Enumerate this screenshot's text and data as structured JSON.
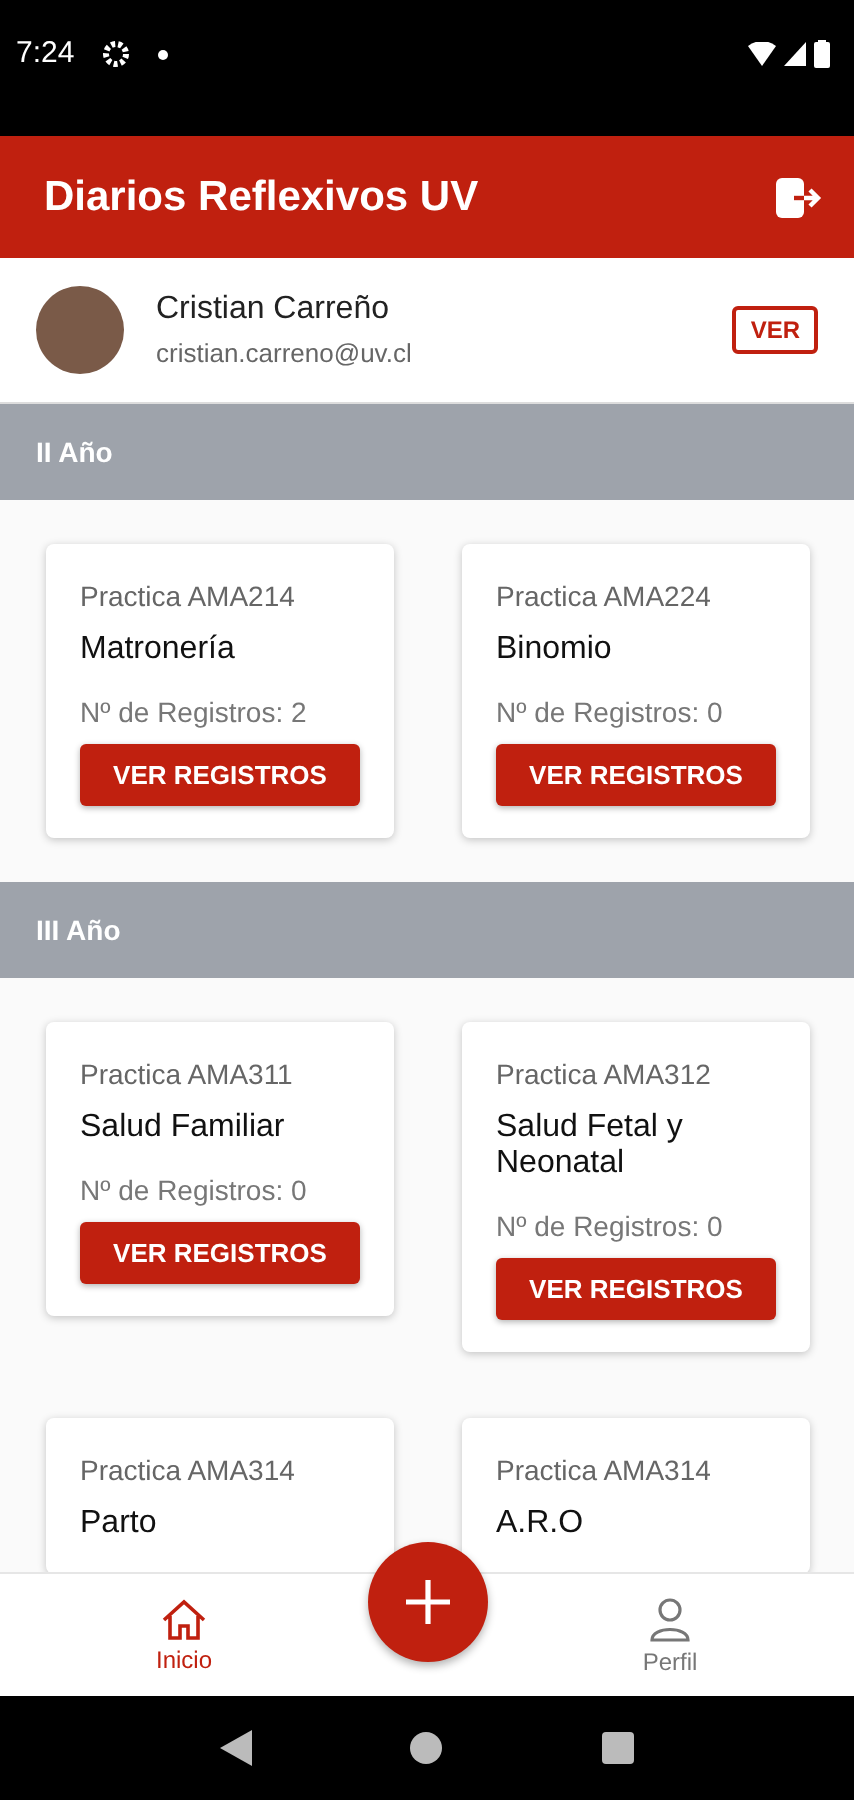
{
  "status_bar": {
    "time": "7:24"
  },
  "app_bar": {
    "title": "Diarios Reflexivos UV"
  },
  "profile": {
    "name": "Cristian Carreño",
    "email": "cristian.carreno@uv.cl",
    "button": "VER"
  },
  "sections": [
    {
      "title": "II Año",
      "courses": [
        {
          "code": "Practica AMA214",
          "name": "Matronería",
          "count": "Nº de Registros: 2",
          "button": "VER REGISTROS"
        },
        {
          "code": "Practica AMA224",
          "name": "Binomio",
          "count": "Nº de Registros: 0",
          "button": "VER REGISTROS"
        }
      ]
    },
    {
      "title": "III Año",
      "courses": [
        {
          "code": "Practica AMA311",
          "name": "Salud Familiar",
          "count": "Nº de Registros: 0",
          "button": "VER REGISTROS"
        },
        {
          "code": "Practica AMA312",
          "name": "Salud Fetal y Neonatal",
          "count": "Nº de Registros: 0",
          "button": "VER REGISTROS"
        },
        {
          "code": "Practica AMA314",
          "name": "Parto"
        },
        {
          "code": "Practica AMA314",
          "name": "A.R.O"
        }
      ]
    }
  ],
  "bottom_nav": [
    {
      "kind": "home",
      "label": "Inicio",
      "selected": true
    },
    {
      "kind": "person",
      "label": "Perfil",
      "selected": false
    }
  ]
}
